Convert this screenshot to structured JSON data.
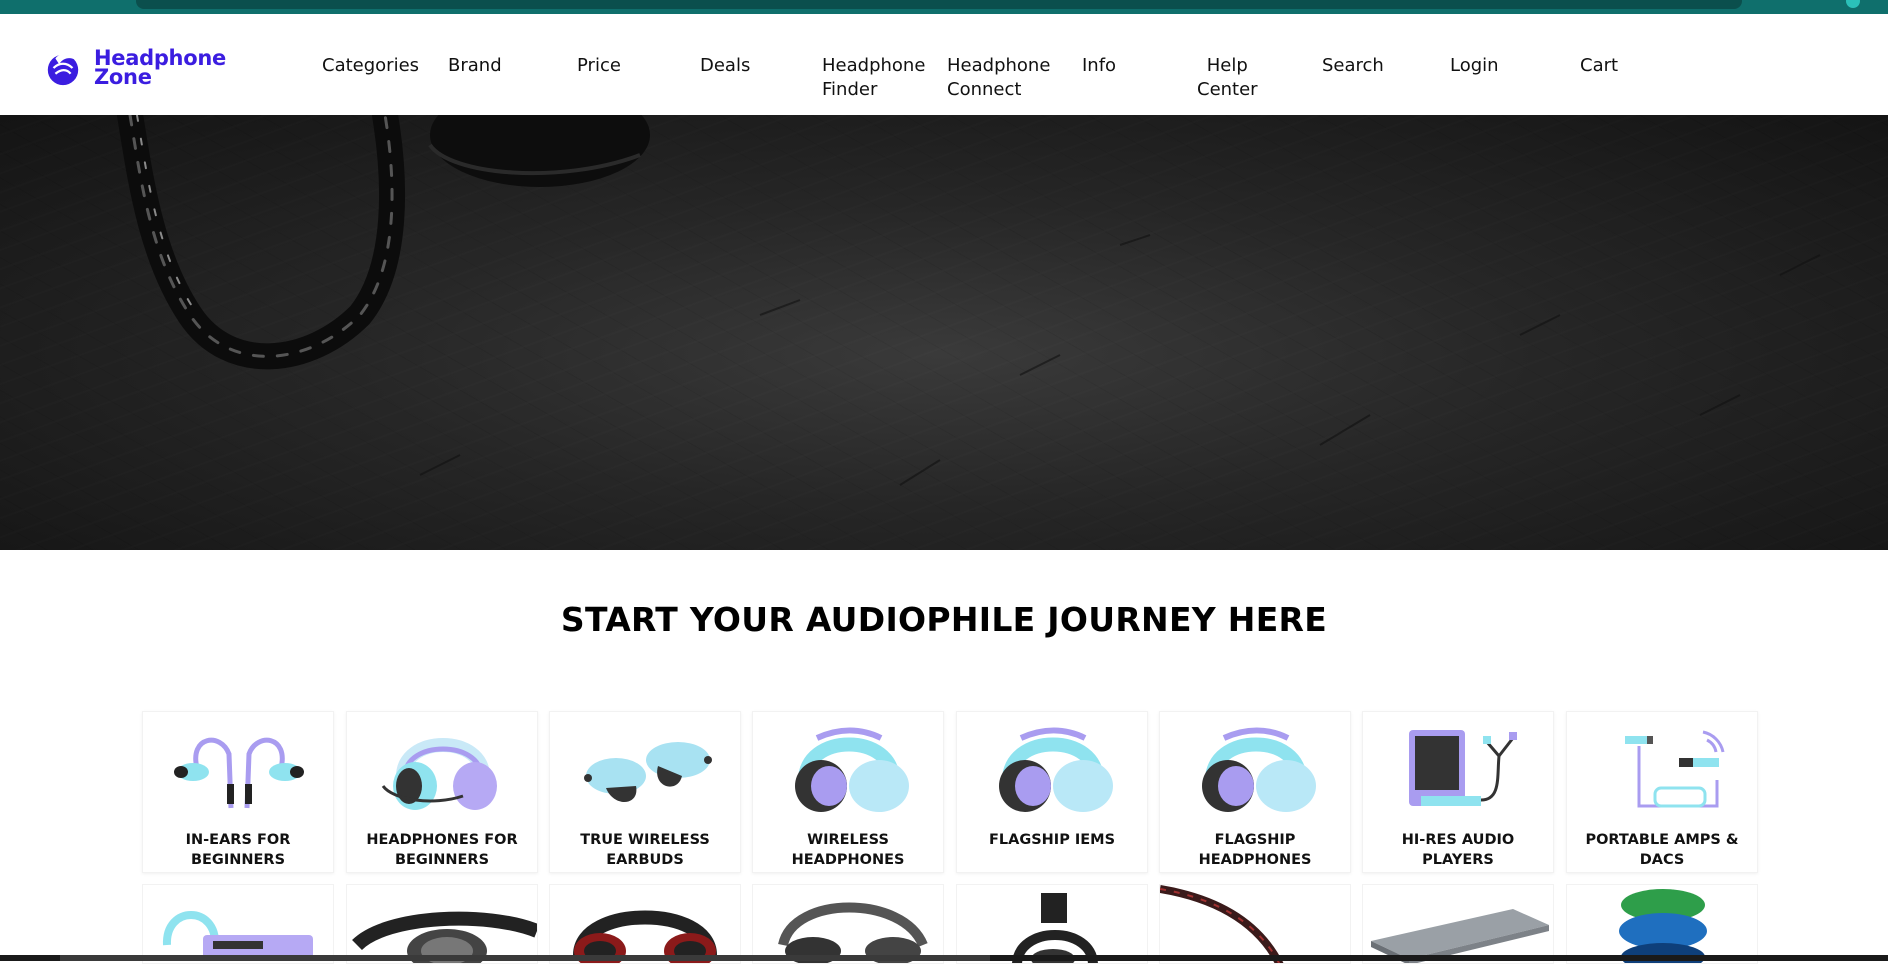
{
  "brand": {
    "name_line1": "Headphone",
    "name_line2": "Zone",
    "color": "#3b1de0"
  },
  "nav": {
    "items": [
      {
        "label": "Categories"
      },
      {
        "label": "Brand"
      },
      {
        "label": "Price"
      },
      {
        "label": "Deals"
      },
      {
        "label": "Headphone\nFinder"
      },
      {
        "label": "Headphone\nConnect"
      },
      {
        "label": "Info"
      },
      {
        "label": "Help\nCenter"
      },
      {
        "label": "Search"
      },
      {
        "label": "Login"
      },
      {
        "label": "Cart"
      }
    ]
  },
  "section": {
    "title": "START YOUR AUDIOPHILE JOURNEY HERE"
  },
  "categories": [
    {
      "label": "IN-EARS FOR BEGINNERS",
      "icon": "iem-icon"
    },
    {
      "label": "HEADPHONES FOR BEGINNERS",
      "icon": "headphones-icon"
    },
    {
      "label": "TRUE WIRELESS EARBUDS",
      "icon": "earbuds-icon"
    },
    {
      "label": "WIRELESS HEADPHONES",
      "icon": "headphones-icon"
    },
    {
      "label": "FLAGSHIP IEMS",
      "icon": "headphones-icon"
    },
    {
      "label": "FLAGSHIP HEADPHONES",
      "icon": "headphones-icon"
    },
    {
      "label": "HI-RES AUDIO PLAYERS",
      "icon": "audio-player-icon"
    },
    {
      "label": "PORTABLE AMPS & DACS",
      "icon": "amp-dac-icon"
    }
  ],
  "colors": {
    "top_strip": "#0f6f6c",
    "icon_lavender": "#a99cf0",
    "icon_cyan": "#8fe3ef"
  }
}
